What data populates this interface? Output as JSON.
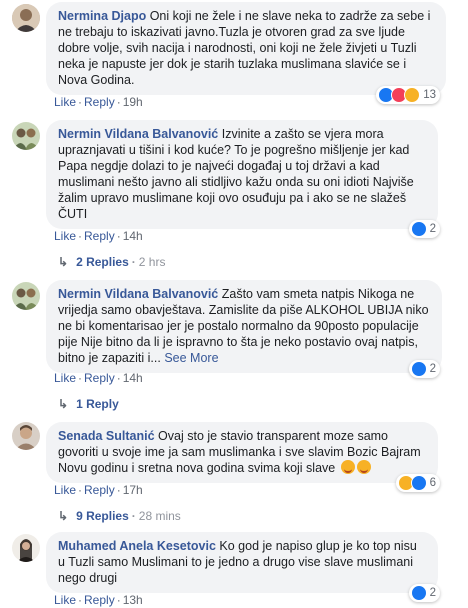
{
  "actions": {
    "like": "Like",
    "reply": "Reply",
    "dot": "·"
  },
  "comments": [
    {
      "name": "Nermina Djapo",
      "text": "Oni koji ne žele i ne slave neka to zadrže za sebe i ne trebaju to iskazivati javno.Tuzla je otvoren grad za sve ljude dobre volje, svih nacija i narodnosti, oni koji ne žele živjeti u Tuzli neka je napuste jer dok je starih tuzlaka muslimana slaviće se i Nova Godina.",
      "time": "19h",
      "reactions": [
        "like",
        "love",
        "haha"
      ],
      "react_count": "13"
    },
    {
      "name": "Nermin Vildana Balvanović",
      "text": "Izvinite a zašto se vjera mora upraznjavati u tišini i kod kuće? To je pogrešno mišljenje jer kad Papa negdje dolazi to je najveći događaj u toj državi a kad muslimani nešto javno ali stidljivo kažu onda su oni idioti Najviše žalim upravo muslimane koji ovo osuđuju pa i ako se ne slažeš ČUTI",
      "time": "14h",
      "reactions": [
        "like"
      ],
      "react_count": "2",
      "replies": "2 Replies",
      "replies_time": "2 hrs"
    },
    {
      "name": "Nermin Vildana Balvanović",
      "text": "Zašto vam smeta natpis Nikoga ne vrijedja samo obavještava. Zamislite da piše ALKOHOL UBIJA niko ne bi komentarisao jer je postalo normalno da 90posto populacije pije Nije bitno da li je ispravno to šta je neko postavio ovaj natpis, bitno je zapaziti i...",
      "see_more": "See More",
      "time": "14h",
      "reactions": [
        "like"
      ],
      "react_count": "2",
      "replies": "1 Reply"
    },
    {
      "name": "Senada Sultanić",
      "text": "Ovaj sto je stavio transparent moze samo govoriti u svoje ime ja sam muslimanka i sve slavim Bozic Bajram Novu godinu i sretna nova godina svima koji slave",
      "time": "17h",
      "reactions": [
        "haha",
        "like"
      ],
      "react_count": "6",
      "replies": "9 Replies",
      "replies_time": "28 mins"
    },
    {
      "name": "Muhamed Anela Kesetovic",
      "text": "Ko god je napiso glup je ko top nisu u Tuzli samo Muslimani to je jedno a drugo vise slave muslimani nego drugi",
      "time": "13h",
      "reactions": [
        "like"
      ],
      "react_count": "2"
    }
  ],
  "colors": {
    "link": "#385898",
    "bubble": "#f2f3f5",
    "like": "#1877f2",
    "love": "#f33e58",
    "haha": "#f7b125"
  }
}
